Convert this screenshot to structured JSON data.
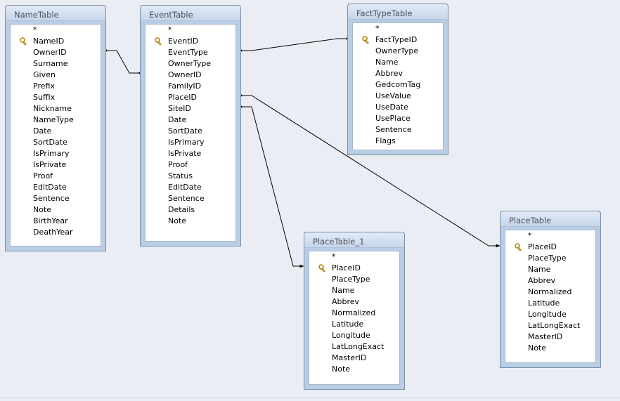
{
  "tables": [
    {
      "id": "name",
      "title": "NameTable",
      "fields": [
        "*",
        "NameID",
        "OwnerID",
        "Surname",
        "Given",
        "Prefix",
        "Suffix",
        "Nickname",
        "NameType",
        "Date",
        "SortDate",
        "IsPrimary",
        "IsPrivate",
        "Proof",
        "EditDate",
        "Sentence",
        "Note",
        "BirthYear",
        "DeathYear"
      ],
      "key_field": "NameID"
    },
    {
      "id": "event",
      "title": "EventTable",
      "fields": [
        "*",
        "EventID",
        "EventType",
        "OwnerType",
        "OwnerID",
        "FamilyID",
        "PlaceID",
        "SiteID",
        "Date",
        "SortDate",
        "IsPrimary",
        "IsPrivate",
        "Proof",
        "Status",
        "EditDate",
        "Sentence",
        "Details",
        "Note"
      ],
      "key_field": "EventID"
    },
    {
      "id": "facttype",
      "title": "FactTypeTable",
      "fields": [
        "*",
        "FactTypeID",
        "OwnerType",
        "Name",
        "Abbrev",
        "GedcomTag",
        "UseValue",
        "UseDate",
        "UsePlace",
        "Sentence",
        "Flags"
      ],
      "key_field": "FactTypeID"
    },
    {
      "id": "place1",
      "title": "PlaceTable_1",
      "fields": [
        "*",
        "PlaceID",
        "PlaceType",
        "Name",
        "Abbrev",
        "Normalized",
        "Latitude",
        "Longitude",
        "LatLongExact",
        "MasterID",
        "Note"
      ],
      "key_field": "PlaceID"
    },
    {
      "id": "place",
      "title": "PlaceTable",
      "fields": [
        "*",
        "PlaceID",
        "PlaceType",
        "Name",
        "Abbrev",
        "Normalized",
        "Latitude",
        "Longitude",
        "LatLongExact",
        "MasterID",
        "Note"
      ],
      "key_field": "PlaceID"
    }
  ],
  "relationships": [
    {
      "from": "name.OwnerID",
      "to": "event.EventID"
    },
    {
      "from": "event.EventType",
      "to": "facttype.FactTypeID"
    },
    {
      "from": "event.PlaceID",
      "to": "place.PlaceID"
    },
    {
      "from": "event.SiteID",
      "to": "place1.PlaceID"
    }
  ],
  "colors": {
    "table_frame": "#b9cde5",
    "title_text": "#4a4f57",
    "canvas": "#eaeef4",
    "line": "#000000",
    "key": "#e0b429"
  },
  "icons": {
    "primary_key": "key-icon"
  }
}
